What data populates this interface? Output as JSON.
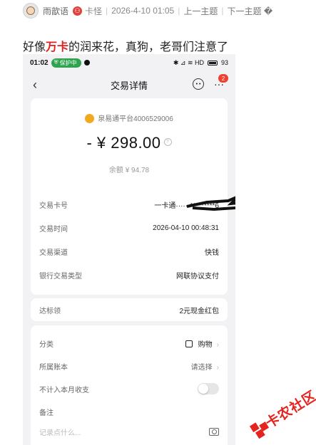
{
  "forum": {
    "username": "雨歆语",
    "user_role": "卡怪",
    "date": "2026-4-10 01:05",
    "prev_topic": "上一主题",
    "next_topic": "下一主题 �",
    "post_prefix": "好像",
    "post_highlight": "万卡",
    "post_suffix": "的润来花，真狗，老哥们注意了"
  },
  "phone": {
    "status_time": "01:02",
    "status_shield": "保护中",
    "status_icons": "✱ ⊿ ≋ HD",
    "battery": "93",
    "nav_back": "‹",
    "nav_title": "交易详情",
    "badge_count": "2",
    "merchant": "泉易通平台4006529006",
    "amount": "- ¥ 298.00",
    "balance": "余额 ¥ 94.78",
    "details": [
      {
        "label": "交易卡号",
        "value": "一卡通······*********6"
      },
      {
        "label": "交易时间",
        "value": "2026-04-10 00:48:31"
      },
      {
        "label": "交易渠道",
        "value": "快钱"
      },
      {
        "label": "银行交易类型",
        "value": "网联协议支付"
      }
    ],
    "reward": {
      "label": "达标领",
      "value": "2元现金红包"
    },
    "extra": {
      "category_label": "分类",
      "category_value": "购物",
      "account_label": "所属账本",
      "account_value": "请选择",
      "exclude_label": "不计入本月收支",
      "note_label": "备注",
      "note_placeholder": "记录点什么..."
    }
  },
  "watermark": {
    "text": "卡农社区"
  },
  "colors": {
    "highlight_red": "#e02020",
    "shield_green": "#2ea44f",
    "merchant_orange": "#f3a91e",
    "badge_red": "#f04030"
  }
}
